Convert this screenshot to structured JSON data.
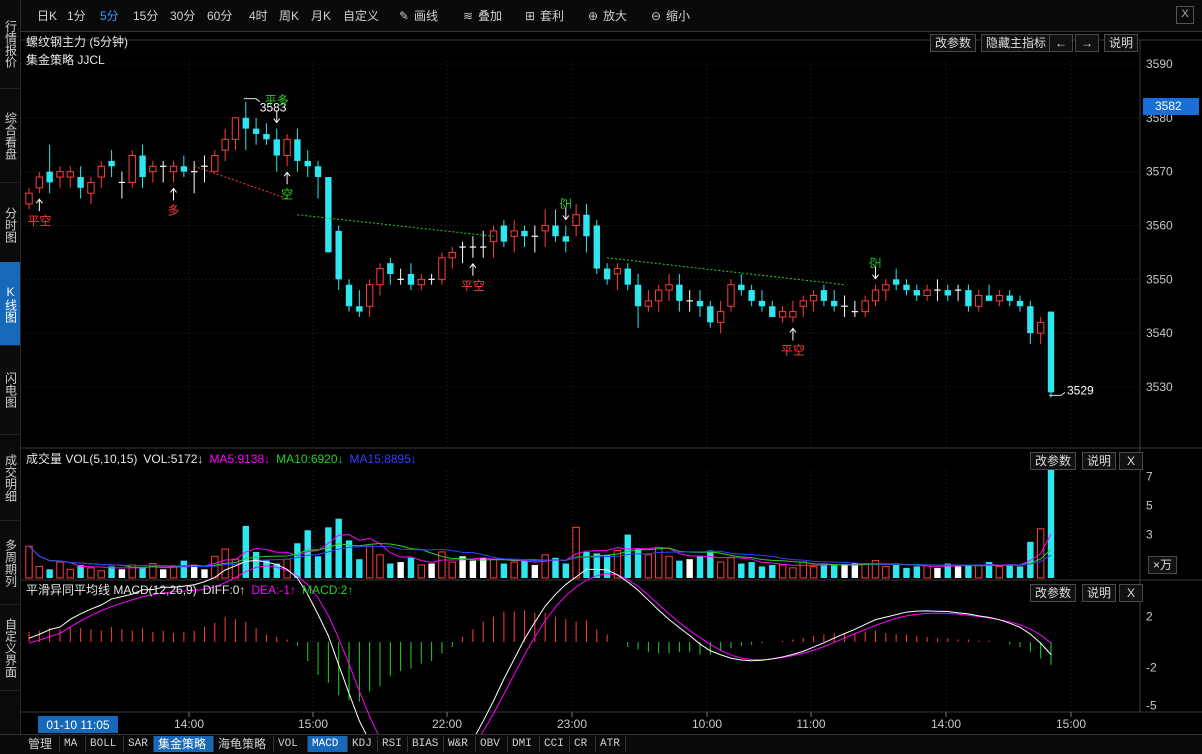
{
  "left_tabs": [
    {
      "label": "行情报价",
      "active": false
    },
    {
      "label": "综合看盘",
      "active": false
    },
    {
      "label": "分时图",
      "active": false
    },
    {
      "label": "K线图",
      "active": true
    },
    {
      "label": "闪电图",
      "active": false
    },
    {
      "label": "成交明细",
      "active": false
    },
    {
      "label": "多周期列",
      "active": false
    },
    {
      "label": "自定义界面",
      "active": false
    }
  ],
  "toolbar": {
    "periods": [
      "日K",
      "1分",
      "5分",
      "15分",
      "30分",
      "60分",
      "4时",
      "周K",
      "月K",
      "自定义"
    ],
    "active_period": "5分",
    "tools": [
      {
        "label": "画线",
        "icon": "pencil-icon"
      },
      {
        "label": "叠加",
        "icon": "stack-icon"
      },
      {
        "label": "套利",
        "icon": "arbitrage-icon"
      },
      {
        "label": "放大",
        "icon": "zoom-in-icon"
      },
      {
        "label": "缩小",
        "icon": "zoom-out-icon"
      }
    ],
    "close": "X"
  },
  "main_panel": {
    "title": "螺纹钢主力 (5分钟)",
    "subtitle": "集金策略 JJCL",
    "buttons": {
      "params": "改参数",
      "hide": "隐藏主指标",
      "left": "←",
      "right": "→",
      "help": "说明"
    },
    "price_axis": [
      "3590",
      "3580",
      "3570",
      "3560",
      "3550",
      "3540",
      "3530"
    ],
    "current_price": "3582",
    "high_label": "3583",
    "low_label": "3529",
    "signals": [
      {
        "text": "平空",
        "color": "#ff3b3b"
      },
      {
        "text": "多",
        "color": "#ff3b3b"
      },
      {
        "text": "平多",
        "color": "#22d322"
      },
      {
        "text": "空",
        "color": "#22d322"
      },
      {
        "text": "平空",
        "color": "#ff3b3b"
      },
      {
        "text": "空",
        "color": "#22d322"
      },
      {
        "text": "平空",
        "color": "#ff3b3b"
      },
      {
        "text": "空",
        "color": "#22d322"
      }
    ]
  },
  "volume_panel": {
    "label": "成交量 VOL(5,10,15)",
    "vol": "VOL:5172↓",
    "ma5": "MA5:9138↓",
    "ma10": "MA10:6920↓",
    "ma15": "MA15:8895↓",
    "buttons": {
      "params": "改参数",
      "help": "说明",
      "close": "X"
    },
    "axis": [
      "7",
      "5",
      "3"
    ],
    "unit": "×万"
  },
  "macd_panel": {
    "label": "平滑异同平均线 MACD(12,26,9)",
    "diff": "DIFF:0↑",
    "dea": "DEA:-1↑",
    "macd": "MACD:2↑",
    "buttons": {
      "params": "改参数",
      "help": "说明",
      "close": "X"
    },
    "axis": [
      "2",
      "-2",
      "-5"
    ]
  },
  "time_axis": {
    "cursor": "01-10 11:05",
    "ticks": [
      "14:00",
      "15:00",
      "22:00",
      "23:00",
      "10:00",
      "11:00",
      "14:00",
      "15:00"
    ]
  },
  "bottom_tabs": [
    {
      "label": "管理",
      "style": "cn"
    },
    {
      "label": "MA",
      "style": ""
    },
    {
      "label": "BOLL",
      "style": ""
    },
    {
      "label": "SAR",
      "style": ""
    },
    {
      "label": "集金策略",
      "style": "active"
    },
    {
      "label": "海龟策略",
      "style": "cn"
    },
    {
      "label": "VOL",
      "style": ""
    },
    {
      "label": "MACD",
      "style": "active"
    },
    {
      "label": "KDJ",
      "style": ""
    },
    {
      "label": "RSI",
      "style": ""
    },
    {
      "label": "BIAS",
      "style": ""
    },
    {
      "label": "W&R",
      "style": ""
    },
    {
      "label": "OBV",
      "style": ""
    },
    {
      "label": "DMI",
      "style": ""
    },
    {
      "label": "CCI",
      "style": ""
    },
    {
      "label": "CR",
      "style": ""
    },
    {
      "label": "ATR",
      "style": ""
    }
  ],
  "colors": {
    "up": "#ff3b3b",
    "down": "#2ee6f0",
    "flat": "#ffffff",
    "accent": "#1668b8",
    "ma5": "#ff00ff",
    "ma10": "#22d322",
    "ma15": "#3040ff"
  },
  "chart_data": {
    "type": "candlestick",
    "ohlc": [
      [
        3564,
        3567,
        3563,
        3566
      ],
      [
        3567,
        3570,
        3566,
        3569
      ],
      [
        3570,
        3575,
        3566,
        3568
      ],
      [
        3569,
        3571,
        3567,
        3570
      ],
      [
        3569,
        3571,
        3567,
        3570
      ],
      [
        3569,
        3571,
        3565,
        3567
      ],
      [
        3566,
        3569,
        3564,
        3568
      ],
      [
        3569,
        3572,
        3567,
        3571
      ],
      [
        3572,
        3574,
        3569,
        3571
      ],
      [
        3568,
        3570,
        3565,
        3568
      ],
      [
        3568,
        3574,
        3567,
        3573
      ],
      [
        3573,
        3575,
        3567,
        3569
      ],
      [
        3570,
        3572,
        3568,
        3571
      ],
      [
        3571,
        3572,
        3568,
        3571
      ],
      [
        3570,
        3572,
        3568,
        3571
      ],
      [
        3571,
        3573,
        3569,
        3570
      ],
      [
        3570,
        3572,
        3566,
        3570
      ],
      [
        3571,
        3573,
        3568,
        3571
      ],
      [
        3570,
        3574,
        3570,
        3573
      ],
      [
        3574,
        3578,
        3572,
        3576
      ],
      [
        3576,
        3580,
        3574,
        3580
      ],
      [
        3580,
        3583,
        3574,
        3578
      ],
      [
        3578,
        3580,
        3575,
        3577
      ],
      [
        3577,
        3579,
        3575,
        3576
      ],
      [
        3576,
        3578,
        3570,
        3573
      ],
      [
        3573,
        3577,
        3571,
        3576
      ],
      [
        3576,
        3578,
        3570,
        3572
      ],
      [
        3572,
        3574,
        3569,
        3571
      ],
      [
        3571,
        3572,
        3565,
        3569
      ],
      [
        3569,
        3566,
        3555,
        3555
      ],
      [
        3559,
        3560,
        3548,
        3550
      ],
      [
        3549,
        3550,
        3544,
        3545
      ],
      [
        3545,
        3548,
        3543,
        3544
      ],
      [
        3545,
        3550,
        3543,
        3549
      ],
      [
        3549,
        3553,
        3547,
        3552
      ],
      [
        3553,
        3554,
        3549,
        3551
      ],
      [
        3550,
        3552,
        3549,
        3550
      ],
      [
        3551,
        3553,
        3548,
        3549
      ],
      [
        3549,
        3551,
        3548,
        3550
      ],
      [
        3550,
        3551,
        3549,
        3550
      ],
      [
        3550,
        3555,
        3549,
        3554
      ],
      [
        3554,
        3556,
        3552,
        3555
      ],
      [
        3556,
        3557,
        3553,
        3556
      ],
      [
        3556,
        3558,
        3554,
        3556
      ],
      [
        3556,
        3559,
        3554,
        3556
      ],
      [
        3557,
        3560,
        3554,
        3559
      ],
      [
        3560,
        3561,
        3556,
        3557
      ],
      [
        3558,
        3561,
        3555,
        3559
      ],
      [
        3559,
        3560,
        3556,
        3558
      ],
      [
        3558,
        3560,
        3555,
        3558
      ],
      [
        3559,
        3563,
        3556,
        3560
      ],
      [
        3560,
        3563,
        3557,
        3558
      ],
      [
        3558,
        3560,
        3555,
        3557
      ],
      [
        3560,
        3564,
        3558,
        3562
      ],
      [
        3562,
        3564,
        3555,
        3558
      ],
      [
        3560,
        3561,
        3551,
        3552
      ],
      [
        3552,
        3553,
        3549,
        3550
      ],
      [
        3551,
        3553,
        3548,
        3552
      ],
      [
        3552,
        3553,
        3548,
        3549
      ],
      [
        3549,
        3551,
        3541,
        3545
      ],
      [
        3545,
        3548,
        3544,
        3546
      ],
      [
        3546,
        3549,
        3544,
        3548
      ],
      [
        3548,
        3551,
        3546,
        3549
      ],
      [
        3549,
        3551,
        3544,
        3546
      ],
      [
        3546,
        3548,
        3544,
        3546
      ],
      [
        3546,
        3548,
        3543,
        3545
      ],
      [
        3545,
        3546,
        3541,
        3542
      ],
      [
        3542,
        3546,
        3540,
        3544
      ],
      [
        3545,
        3550,
        3544,
        3549
      ],
      [
        3549,
        3551,
        3547,
        3548
      ],
      [
        3548,
        3549,
        3545,
        3546
      ],
      [
        3546,
        3548,
        3544,
        3545
      ],
      [
        3545,
        3546,
        3543,
        3543
      ],
      [
        3543,
        3545,
        3542,
        3544
      ],
      [
        3543,
        3546,
        3542,
        3544
      ],
      [
        3545,
        3547,
        3543,
        3546
      ],
      [
        3546,
        3548,
        3544,
        3547
      ],
      [
        3548,
        3549,
        3545,
        3546
      ],
      [
        3546,
        3548,
        3544,
        3545
      ],
      [
        3545,
        3547,
        3543,
        3545
      ],
      [
        3544,
        3546,
        3543,
        3544
      ],
      [
        3544,
        3547,
        3543,
        3546
      ],
      [
        3546,
        3549,
        3545,
        3548
      ],
      [
        3548,
        3550,
        3546,
        3549
      ],
      [
        3550,
        3552,
        3548,
        3549
      ],
      [
        3549,
        3550,
        3547,
        3548
      ],
      [
        3548,
        3549,
        3546,
        3547
      ],
      [
        3547,
        3549,
        3546,
        3548
      ],
      [
        3548,
        3550,
        3546,
        3548
      ],
      [
        3548,
        3549,
        3546,
        3547
      ],
      [
        3548,
        3549,
        3546,
        3548
      ],
      [
        3548,
        3549,
        3544,
        3545
      ],
      [
        3545,
        3548,
        3544,
        3547
      ],
      [
        3547,
        3549,
        3546,
        3546
      ],
      [
        3546,
        3548,
        3545,
        3547
      ],
      [
        3547,
        3548,
        3545,
        3546
      ],
      [
        3546,
        3547,
        3544,
        3545
      ],
      [
        3545,
        3546,
        3538,
        3540
      ],
      [
        3540,
        3543,
        3538,
        3542
      ],
      [
        3544,
        3544,
        3528,
        3529
      ]
    ],
    "volume": [
      2.2,
      0.8,
      0.6,
      1.1,
      0.6,
      0.9,
      0.7,
      0.5,
      0.8,
      0.6,
      0.9,
      0.7,
      1.0,
      0.6,
      0.8,
      1.2,
      0.9,
      0.6,
      1.5,
      2.0,
      1.3,
      3.6,
      1.8,
      1.2,
      1.0,
      1.3,
      2.4,
      3.3,
      1.5,
      3.5,
      4.1,
      2.6,
      1.3,
      2.2,
      1.6,
      1.0,
      1.1,
      1.4,
      0.9,
      1.0,
      1.8,
      1.1,
      1.5,
      1.2,
      1.4,
      1.3,
      1.0,
      1.1,
      1.2,
      0.9,
      1.6,
      1.4,
      1.0,
      3.5,
      1.8,
      1.7,
      1.6,
      1.9,
      3.0,
      2.0,
      1.6,
      2.1,
      1.5,
      1.2,
      1.3,
      1.5,
      1.9,
      1.1,
      1.4,
      1.0,
      1.1,
      0.8,
      0.9,
      0.9,
      0.7,
      1.1,
      0.8,
      1.0,
      0.9,
      0.9,
      1.0,
      1.0,
      1.2,
      0.8,
      0.9,
      0.7,
      0.8,
      0.9,
      0.7,
      1.0,
      0.8,
      0.9,
      0.9,
      1.1,
      0.8,
      0.9,
      0.8,
      2.5,
      3.4,
      7.6
    ],
    "macd_hist": [
      0.8,
      0.9,
      1.1,
      1.0,
      1.2,
      1.1,
      1.0,
      0.9,
      1.2,
      1.0,
      0.9,
      1.1,
      0.8,
      0.9,
      0.7,
      0.8,
      0.9,
      1.2,
      1.5,
      2.0,
      1.8,
      1.6,
      1.1,
      0.6,
      0.4,
      0.2,
      -0.3,
      -1.5,
      -2.6,
      -3.2,
      -4.2,
      -4.6,
      -4.7,
      -3.9,
      -3.5,
      -2.7,
      -2.3,
      -2.1,
      -1.7,
      -1.5,
      -0.9,
      -0.4,
      0.4,
      1.0,
      1.6,
      2.0,
      2.4,
      2.4,
      2.5,
      2.3,
      2.3,
      2.0,
      1.8,
      1.6,
      1.7,
      1.0,
      0.6,
      0.0,
      -0.4,
      -0.6,
      -0.8,
      -0.9,
      -0.9,
      -0.8,
      -0.8,
      -1.0,
      -1.0,
      -0.7,
      -0.5,
      -0.3,
      -0.2,
      -0.1,
      0.0,
      0.1,
      0.2,
      0.3,
      0.5,
      0.6,
      0.7,
      0.7,
      0.7,
      0.8,
      0.9,
      0.7,
      0.6,
      0.6,
      0.5,
      0.4,
      0.3,
      0.3,
      0.2,
      0.2,
      0.1,
      0.1,
      0.0,
      -0.2,
      -0.4,
      -0.8,
      -1.3,
      -1.8
    ]
  }
}
